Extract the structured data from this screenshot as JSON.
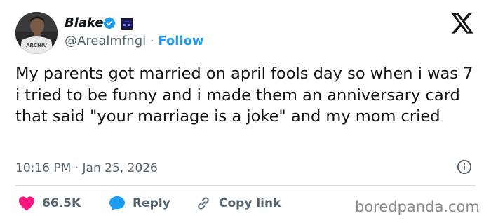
{
  "author": {
    "name": "Blake",
    "handle": "@Arealmfngl",
    "separator": "·",
    "follow_label": "Follow",
    "avatar_shirt_text": "ARCHIV",
    "verified_color": "#1d9bf0"
  },
  "tweet": {
    "text": "My parents got married on april fools day so when i was 7 i tried to be funny and i made them an anniversary card that said \"your marriage is a joke\" and my mom cried",
    "timestamp": "10:16 PM · Jan 25, 2026"
  },
  "actions": {
    "likes_count": "66.5K",
    "reply_label": "Reply",
    "copy_link_label": "Copy link",
    "like_color": "#f91880",
    "reply_color": "#1d9bf0"
  },
  "icons": {
    "platform_logo": "x-logo-icon",
    "verified": "verified-badge-icon",
    "affiliate": "affiliate-badge-icon",
    "info": "info-icon",
    "like": "heart-icon",
    "reply": "speech-bubble-icon",
    "copy_link": "link-icon"
  },
  "watermark": "boredpanda.com"
}
